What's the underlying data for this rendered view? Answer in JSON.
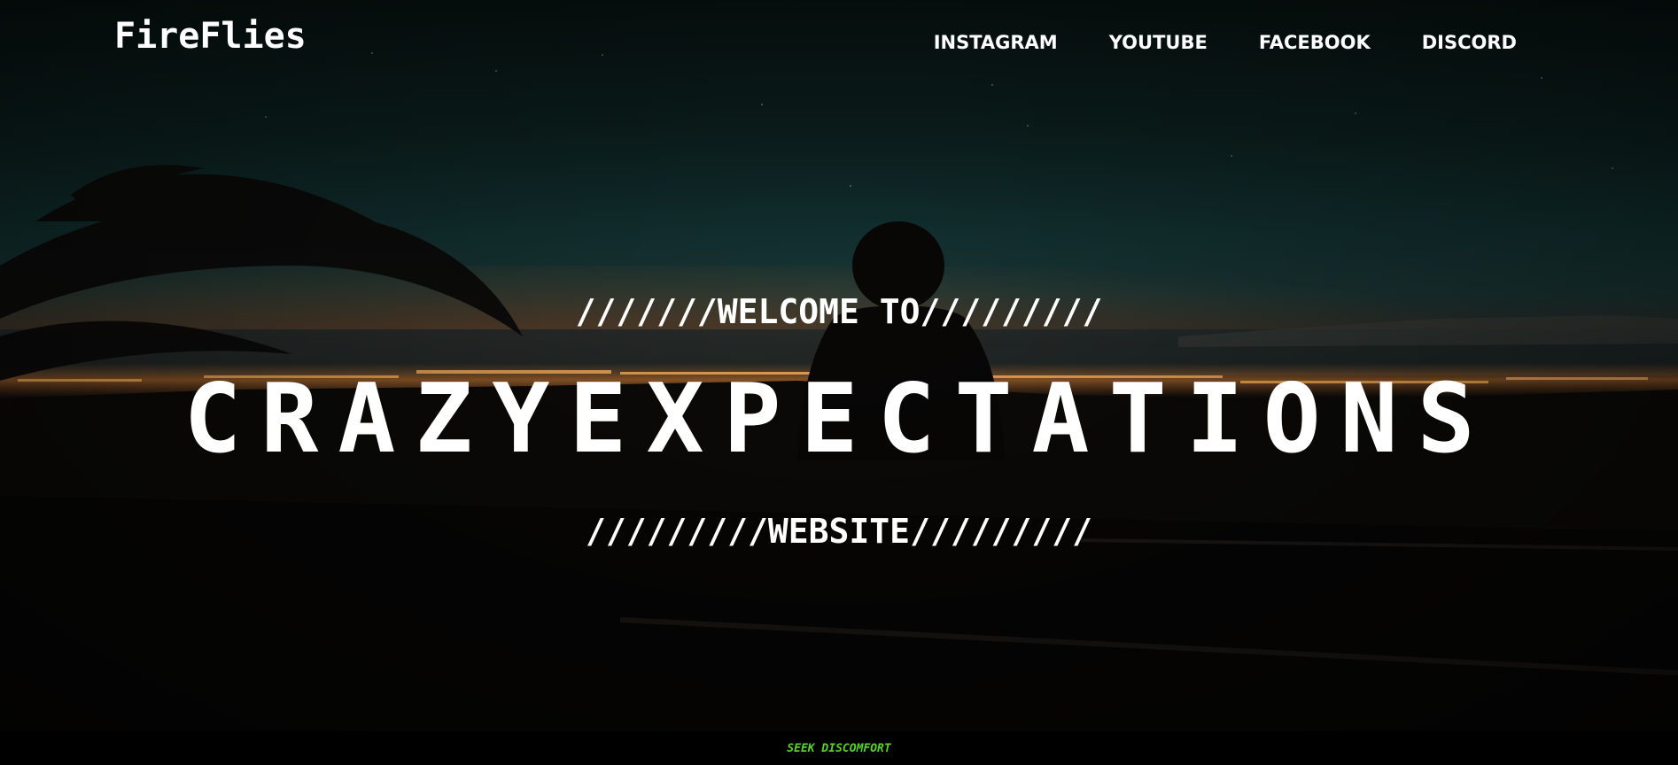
{
  "brand": {
    "logo_text": "FireFlies"
  },
  "nav": {
    "items": [
      {
        "label": "INSTAGRAM"
      },
      {
        "label": "YOUTUBE"
      },
      {
        "label": "FACEBOOK"
      },
      {
        "label": "DISCORD"
      }
    ]
  },
  "hero": {
    "welcome_text": "///////WELCOME TO/////////",
    "headline": "CRAZYEXPECTATIONS",
    "subline": "/////////WEBSITE/////////"
  },
  "footer": {
    "tagline": "SEEK DISCOMFORT"
  },
  "colors": {
    "text": "#ffffff",
    "footer_bg": "#000000",
    "tagline": "#5bcf2a",
    "sky_top": "#07110f",
    "city_lights": "#ff9a3c"
  }
}
